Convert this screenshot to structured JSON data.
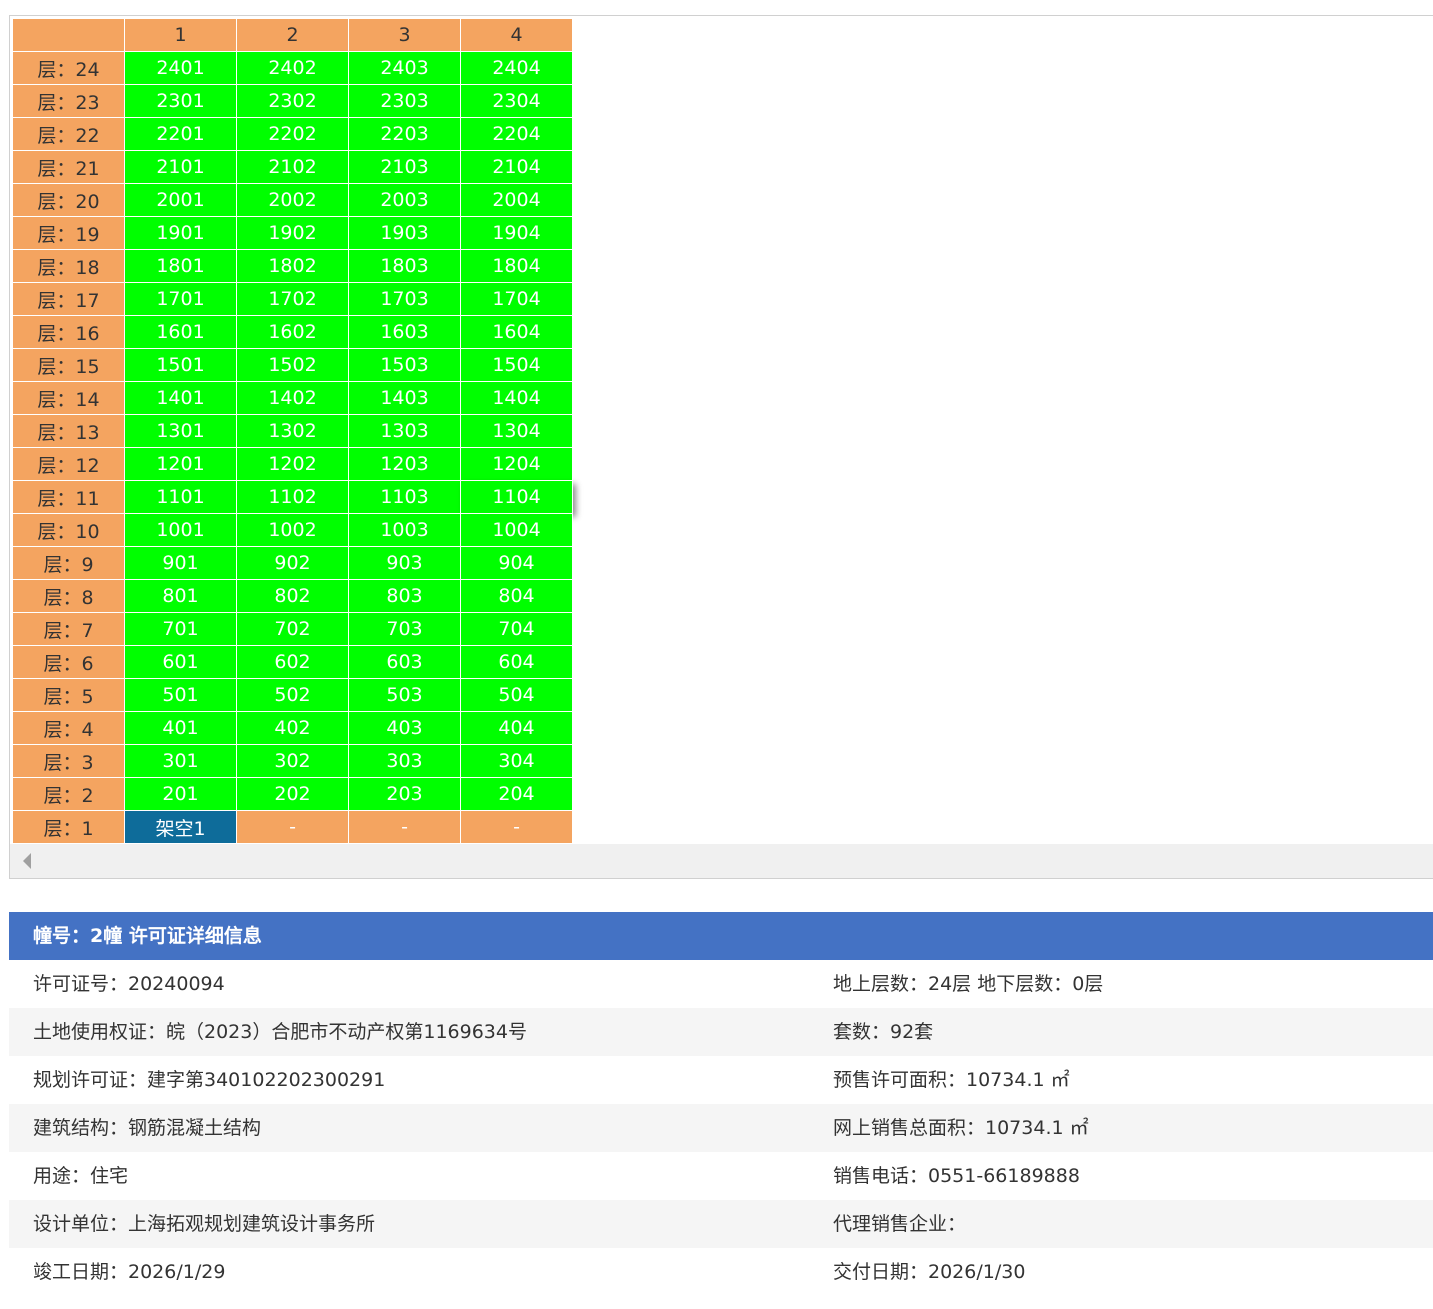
{
  "column_headers": [
    "",
    "1",
    "2",
    "3",
    "4"
  ],
  "floors": [
    {
      "label": "层：24",
      "units": [
        "2401",
        "2402",
        "2403",
        "2404"
      ]
    },
    {
      "label": "层：23",
      "units": [
        "2301",
        "2302",
        "2303",
        "2304"
      ]
    },
    {
      "label": "层：22",
      "units": [
        "2201",
        "2202",
        "2203",
        "2204"
      ]
    },
    {
      "label": "层：21",
      "units": [
        "2101",
        "2102",
        "2103",
        "2104"
      ]
    },
    {
      "label": "层：20",
      "units": [
        "2001",
        "2002",
        "2003",
        "2004"
      ]
    },
    {
      "label": "层：19",
      "units": [
        "1901",
        "1902",
        "1903",
        "1904"
      ]
    },
    {
      "label": "层：18",
      "units": [
        "1801",
        "1802",
        "1803",
        "1804"
      ]
    },
    {
      "label": "层：17",
      "units": [
        "1701",
        "1702",
        "1703",
        "1704"
      ]
    },
    {
      "label": "层：16",
      "units": [
        "1601",
        "1602",
        "1603",
        "1604"
      ]
    },
    {
      "label": "层：15",
      "units": [
        "1501",
        "1502",
        "1503",
        "1504"
      ]
    },
    {
      "label": "层：14",
      "units": [
        "1401",
        "1402",
        "1403",
        "1404"
      ]
    },
    {
      "label": "层：13",
      "units": [
        "1301",
        "1302",
        "1303",
        "1304"
      ]
    },
    {
      "label": "层：12",
      "units": [
        "1201",
        "1202",
        "1203",
        "1204"
      ]
    },
    {
      "label": "层：11",
      "units": [
        "1101",
        "1102",
        "1103",
        "1104"
      ]
    },
    {
      "label": "层：10",
      "units": [
        "1001",
        "1002",
        "1003",
        "1004"
      ]
    },
    {
      "label": "层：9",
      "units": [
        "901",
        "902",
        "903",
        "904"
      ]
    },
    {
      "label": "层：8",
      "units": [
        "801",
        "802",
        "803",
        "804"
      ]
    },
    {
      "label": "层：7",
      "units": [
        "701",
        "702",
        "703",
        "704"
      ]
    },
    {
      "label": "层：6",
      "units": [
        "601",
        "602",
        "603",
        "604"
      ]
    },
    {
      "label": "层：5",
      "units": [
        "501",
        "502",
        "503",
        "504"
      ]
    },
    {
      "label": "层：4",
      "units": [
        "401",
        "402",
        "403",
        "404"
      ]
    },
    {
      "label": "层：3",
      "units": [
        "301",
        "302",
        "303",
        "304"
      ]
    },
    {
      "label": "层：2",
      "units": [
        "201",
        "202",
        "203",
        "204"
      ]
    }
  ],
  "ground_floor": {
    "label": "层：1",
    "cells": [
      {
        "text": "架空1",
        "kind": "open"
      },
      {
        "text": "-",
        "kind": "empty"
      },
      {
        "text": "-",
        "kind": "empty"
      },
      {
        "text": "-",
        "kind": "empty"
      }
    ]
  },
  "colors": {
    "available": "#00ff00",
    "floor_label": "#f4a460",
    "open_space": "#0e6c9a",
    "header_bar": "#4472c4"
  },
  "info": {
    "title": "幢号：2幢 许可证详细信息",
    "rows": [
      {
        "left": "许可证号：20240094",
        "right": "地上层数：24层  地下层数：0层"
      },
      {
        "left": "土地使用权证：皖（2023）合肥市不动产权第1169634号",
        "right": "套数：92套"
      },
      {
        "left": "规划许可证：建字第340102202300291",
        "right": "预售许可面积：10734.1 ㎡"
      },
      {
        "left": "建筑结构：钢筋混凝土结构",
        "right": "网上销售总面积：10734.1 ㎡"
      },
      {
        "left": "用途：住宅",
        "right": "销售电话：0551-66189888"
      },
      {
        "left": "设计单位：上海拓观规划建筑设计事务所",
        "right": "代理销售企业："
      },
      {
        "left": "竣工日期：2026/1/29",
        "right": "交付日期：2026/1/30"
      }
    ]
  }
}
